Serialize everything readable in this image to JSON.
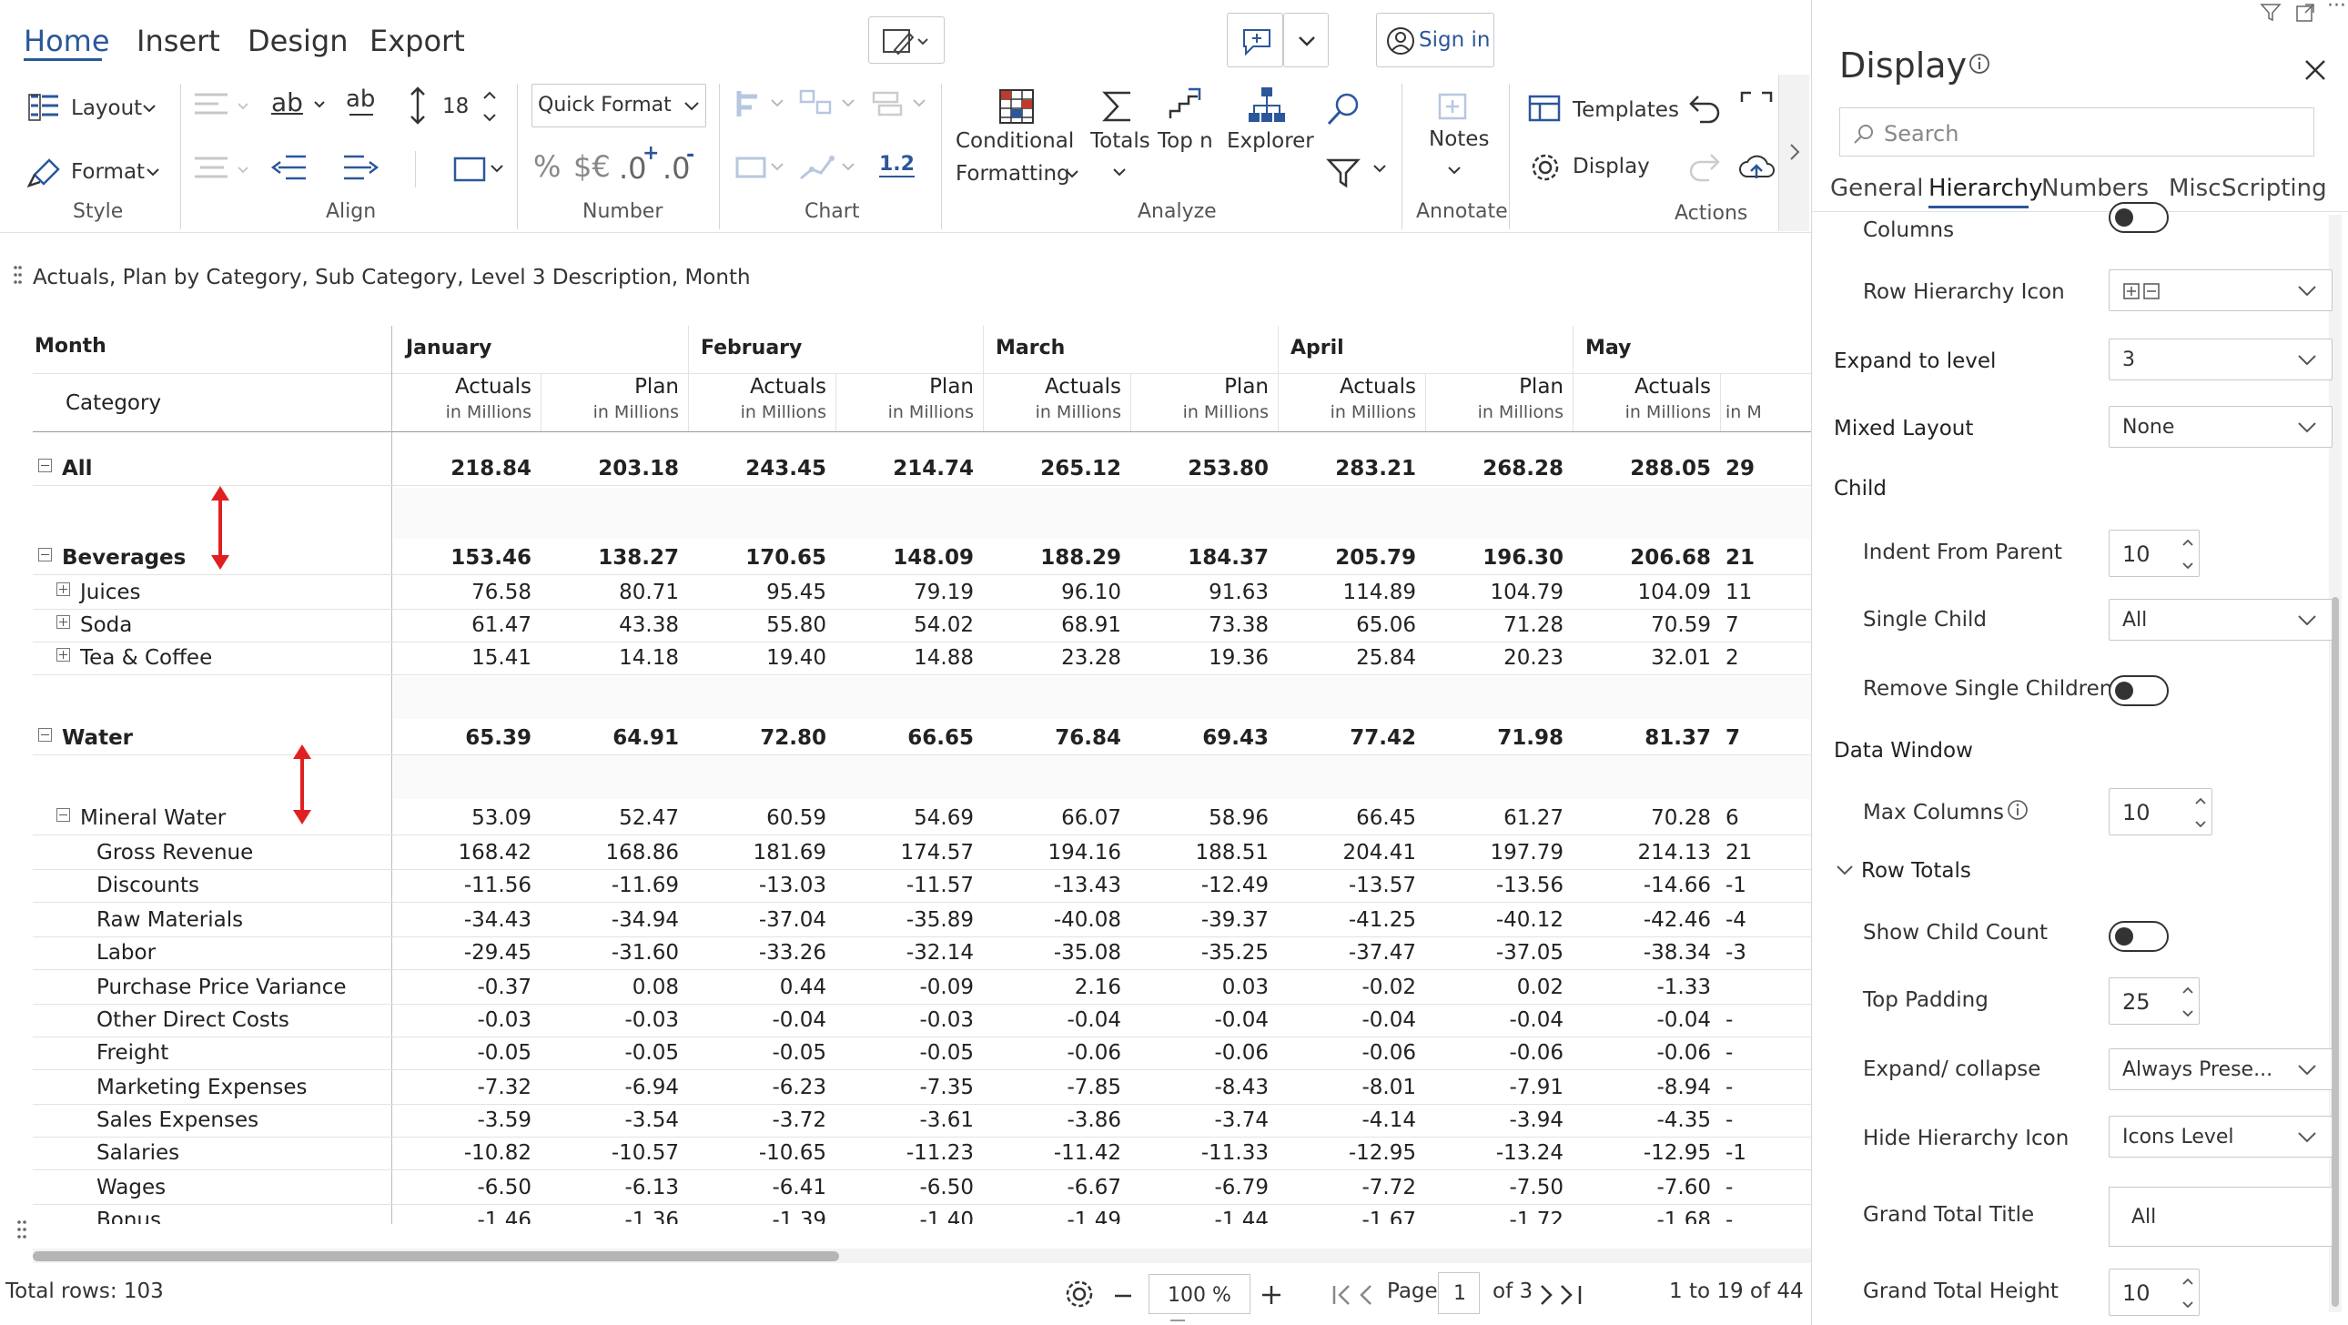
{
  "ribbon": {
    "tabs": [
      "Home",
      "Insert",
      "Design",
      "Export"
    ],
    "sign_in": "Sign in",
    "layout": "Layout",
    "format": "Format",
    "style_group": "Style",
    "align_group": "Align",
    "font_size": "18",
    "quick_format": "Quick Format",
    "number_group": "Number",
    "decimal_label": "1.2",
    "chart_group": "Chart",
    "conditional": "Conditional",
    "formatting": "Formatting",
    "totals": "Totals",
    "topn": "Top n",
    "explorer": "Explorer",
    "analyze_group": "Analyze",
    "notes": "Notes",
    "annotate_group": "Annotate",
    "templates": "Templates",
    "display": "Display",
    "actions_group": "Actions",
    "number_symbols": {
      "percent": "%",
      "dollar_euro": "$€",
      "inc_dec": ".0",
      "dec_dec": ".0"
    }
  },
  "visual_title": "Actuals, Plan by Category, Sub Category, Level 3 Description, Month",
  "grid": {
    "row_header_month": "Month",
    "row_header_category": "Category",
    "months": [
      "January",
      "February",
      "March",
      "April",
      "May"
    ],
    "measures": [
      "Actuals",
      "Plan"
    ],
    "unit": "in Millions",
    "partial_unit": "in M",
    "rows": [
      {
        "label": "All",
        "level": 0,
        "bold": true,
        "icon": "minus",
        "values": [
          "218.84",
          "203.18",
          "243.45",
          "214.74",
          "265.12",
          "253.80",
          "283.21",
          "268.28",
          "288.05",
          "29"
        ]
      },
      {
        "label": "Beverages",
        "level": 0,
        "bold": true,
        "icon": "minus",
        "values": [
          "153.46",
          "138.27",
          "170.65",
          "148.09",
          "188.29",
          "184.37",
          "205.79",
          "196.30",
          "206.68",
          "21"
        ]
      },
      {
        "label": "Juices",
        "level": 1,
        "bold": false,
        "icon": "plus",
        "values": [
          "76.58",
          "80.71",
          "95.45",
          "79.19",
          "96.10",
          "91.63",
          "114.89",
          "104.79",
          "104.09",
          "11"
        ]
      },
      {
        "label": "Soda",
        "level": 1,
        "bold": false,
        "icon": "plus",
        "values": [
          "61.47",
          "43.38",
          "55.80",
          "54.02",
          "68.91",
          "73.38",
          "65.06",
          "71.28",
          "70.59",
          "7"
        ]
      },
      {
        "label": "Tea & Coffee",
        "level": 1,
        "bold": false,
        "icon": "plus",
        "values": [
          "15.41",
          "14.18",
          "19.40",
          "14.88",
          "23.28",
          "19.36",
          "25.84",
          "20.23",
          "32.01",
          "2"
        ]
      },
      {
        "label": "Water",
        "level": 0,
        "bold": true,
        "icon": "minus",
        "values": [
          "65.39",
          "64.91",
          "72.80",
          "66.65",
          "76.84",
          "69.43",
          "77.42",
          "71.98",
          "81.37",
          "7"
        ]
      },
      {
        "label": "Mineral Water",
        "level": 1,
        "bold": false,
        "icon": "minus",
        "values": [
          "53.09",
          "52.47",
          "60.59",
          "54.69",
          "66.07",
          "58.96",
          "66.45",
          "61.27",
          "70.28",
          "6"
        ]
      },
      {
        "label": "Gross Revenue",
        "level": 2,
        "bold": false,
        "icon": "",
        "values": [
          "168.42",
          "168.86",
          "181.69",
          "174.57",
          "194.16",
          "188.51",
          "204.41",
          "197.79",
          "214.13",
          "21"
        ]
      },
      {
        "label": "Discounts",
        "level": 2,
        "bold": false,
        "icon": "",
        "values": [
          "-11.56",
          "-11.69",
          "-13.03",
          "-11.57",
          "-13.43",
          "-12.49",
          "-13.57",
          "-13.56",
          "-14.66",
          "-1"
        ]
      },
      {
        "label": "Raw Materials",
        "level": 2,
        "bold": false,
        "icon": "",
        "values": [
          "-34.43",
          "-34.94",
          "-37.04",
          "-35.89",
          "-40.08",
          "-39.37",
          "-41.25",
          "-40.12",
          "-42.46",
          "-4"
        ]
      },
      {
        "label": "Labor",
        "level": 2,
        "bold": false,
        "icon": "",
        "values": [
          "-29.45",
          "-31.60",
          "-33.26",
          "-32.14",
          "-35.08",
          "-35.25",
          "-37.47",
          "-37.05",
          "-38.34",
          "-3"
        ]
      },
      {
        "label": "Purchase Price Variance",
        "level": 2,
        "bold": false,
        "icon": "",
        "values": [
          "-0.37",
          "0.08",
          "0.44",
          "-0.09",
          "2.16",
          "0.03",
          "-0.02",
          "0.02",
          "-1.33",
          ""
        ]
      },
      {
        "label": "Other Direct Costs",
        "level": 2,
        "bold": false,
        "icon": "",
        "values": [
          "-0.03",
          "-0.03",
          "-0.04",
          "-0.03",
          "-0.04",
          "-0.04",
          "-0.04",
          "-0.04",
          "-0.04",
          "-"
        ]
      },
      {
        "label": "Freight",
        "level": 2,
        "bold": false,
        "icon": "",
        "values": [
          "-0.05",
          "-0.05",
          "-0.05",
          "-0.05",
          "-0.06",
          "-0.06",
          "-0.06",
          "-0.06",
          "-0.06",
          "-"
        ]
      },
      {
        "label": "Marketing Expenses",
        "level": 2,
        "bold": false,
        "icon": "",
        "values": [
          "-7.32",
          "-6.94",
          "-6.23",
          "-7.35",
          "-7.85",
          "-8.43",
          "-8.01",
          "-7.91",
          "-8.94",
          "-"
        ]
      },
      {
        "label": "Sales Expenses",
        "level": 2,
        "bold": false,
        "icon": "",
        "values": [
          "-3.59",
          "-3.54",
          "-3.72",
          "-3.61",
          "-3.86",
          "-3.74",
          "-4.14",
          "-3.94",
          "-4.35",
          "-"
        ]
      },
      {
        "label": "Salaries",
        "level": 2,
        "bold": false,
        "icon": "",
        "values": [
          "-10.82",
          "-10.57",
          "-10.65",
          "-11.23",
          "-11.42",
          "-11.33",
          "-12.95",
          "-13.24",
          "-12.95",
          "-1"
        ]
      },
      {
        "label": "Wages",
        "level": 2,
        "bold": false,
        "icon": "",
        "values": [
          "-6.50",
          "-6.13",
          "-6.41",
          "-6.50",
          "-6.67",
          "-6.79",
          "-7.72",
          "-7.50",
          "-7.60",
          "-"
        ]
      },
      {
        "label": "Bonus",
        "level": 2,
        "bold": false,
        "icon": "",
        "values": [
          "-1.46",
          "-1.36",
          "-1.39",
          "-1.40",
          "-1.49",
          "-1.44",
          "-1.67",
          "-1.72",
          "-1.68",
          "-"
        ]
      }
    ]
  },
  "status": {
    "total_rows": "Total rows: 103",
    "zoom": "100 %",
    "page_label": "Page",
    "page_value": "1",
    "page_of": "of 3",
    "range": "1 to 19 of 44"
  },
  "panel": {
    "title": "Display",
    "search_placeholder": "Search",
    "tabs": [
      "General",
      "Hierarchy",
      "Numbers",
      "Misc.",
      "Scripting"
    ],
    "columns_label": "Columns",
    "row_hierarchy_icon": "Row Hierarchy Icon",
    "expand_to_level": "Expand to level",
    "expand_to_level_value": "3",
    "mixed_layout": "Mixed Layout",
    "mixed_layout_value": "None",
    "child_section": "Child",
    "indent_from_parent": "Indent From Parent",
    "indent_value": "10",
    "single_child": "Single Child",
    "single_child_value": "All",
    "remove_single_children": "Remove Single Children",
    "data_window_section": "Data Window",
    "max_columns": "Max Columns",
    "max_columns_value": "10",
    "row_totals_section": "Row Totals",
    "show_child_count": "Show Child Count",
    "top_padding": "Top Padding",
    "top_padding_value": "25",
    "expand_collapse": "Expand/ collapse",
    "expand_collapse_value": "Always Prese...",
    "hide_hierarchy_icon": "Hide Hierarchy Icon",
    "hide_hierarchy_icon_value": "Icons Level",
    "grand_total_title": "Grand Total Title",
    "grand_total_title_value": "All",
    "grand_total_height": "Grand Total Height",
    "grand_total_height_value": "10"
  },
  "colors": {
    "accent": "#2b579a",
    "annotation_arrow": "#e02020",
    "toggle": "#333333"
  }
}
